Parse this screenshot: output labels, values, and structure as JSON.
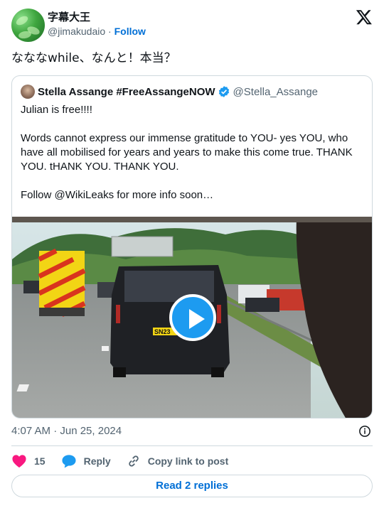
{
  "author": {
    "display_name": "字幕大王",
    "handle": "@jimakudaio",
    "separator": "·",
    "follow_label": "Follow"
  },
  "tweet": {
    "text": "なななwhile、なんと！本当？",
    "timestamp": "4:07 AM · Jun 25, 2024"
  },
  "quoted": {
    "display_name": "Stella Assange #FreeAssangeNOW",
    "handle": "@Stella_Assange",
    "body": "Julian is free!!!!\n\nWords cannot express our immense gratitude to YOU- yes YOU, who have all mobilised for years and years to make this come true. THANK YOU. tHANK YOU. THANK YOU.\n\nFollow @WikiLeaks for more info soon…",
    "media": {
      "type": "video",
      "plate_text": "SN23"
    }
  },
  "actions": {
    "like_count": "15",
    "reply_label": "Reply",
    "copy_label": "Copy link to post"
  },
  "footer": {
    "read_replies_label": "Read 2 replies"
  },
  "colors": {
    "accent": "#006fd6",
    "like": "#f91880",
    "play": "#1d9bf0",
    "border": "#cfd9de"
  }
}
